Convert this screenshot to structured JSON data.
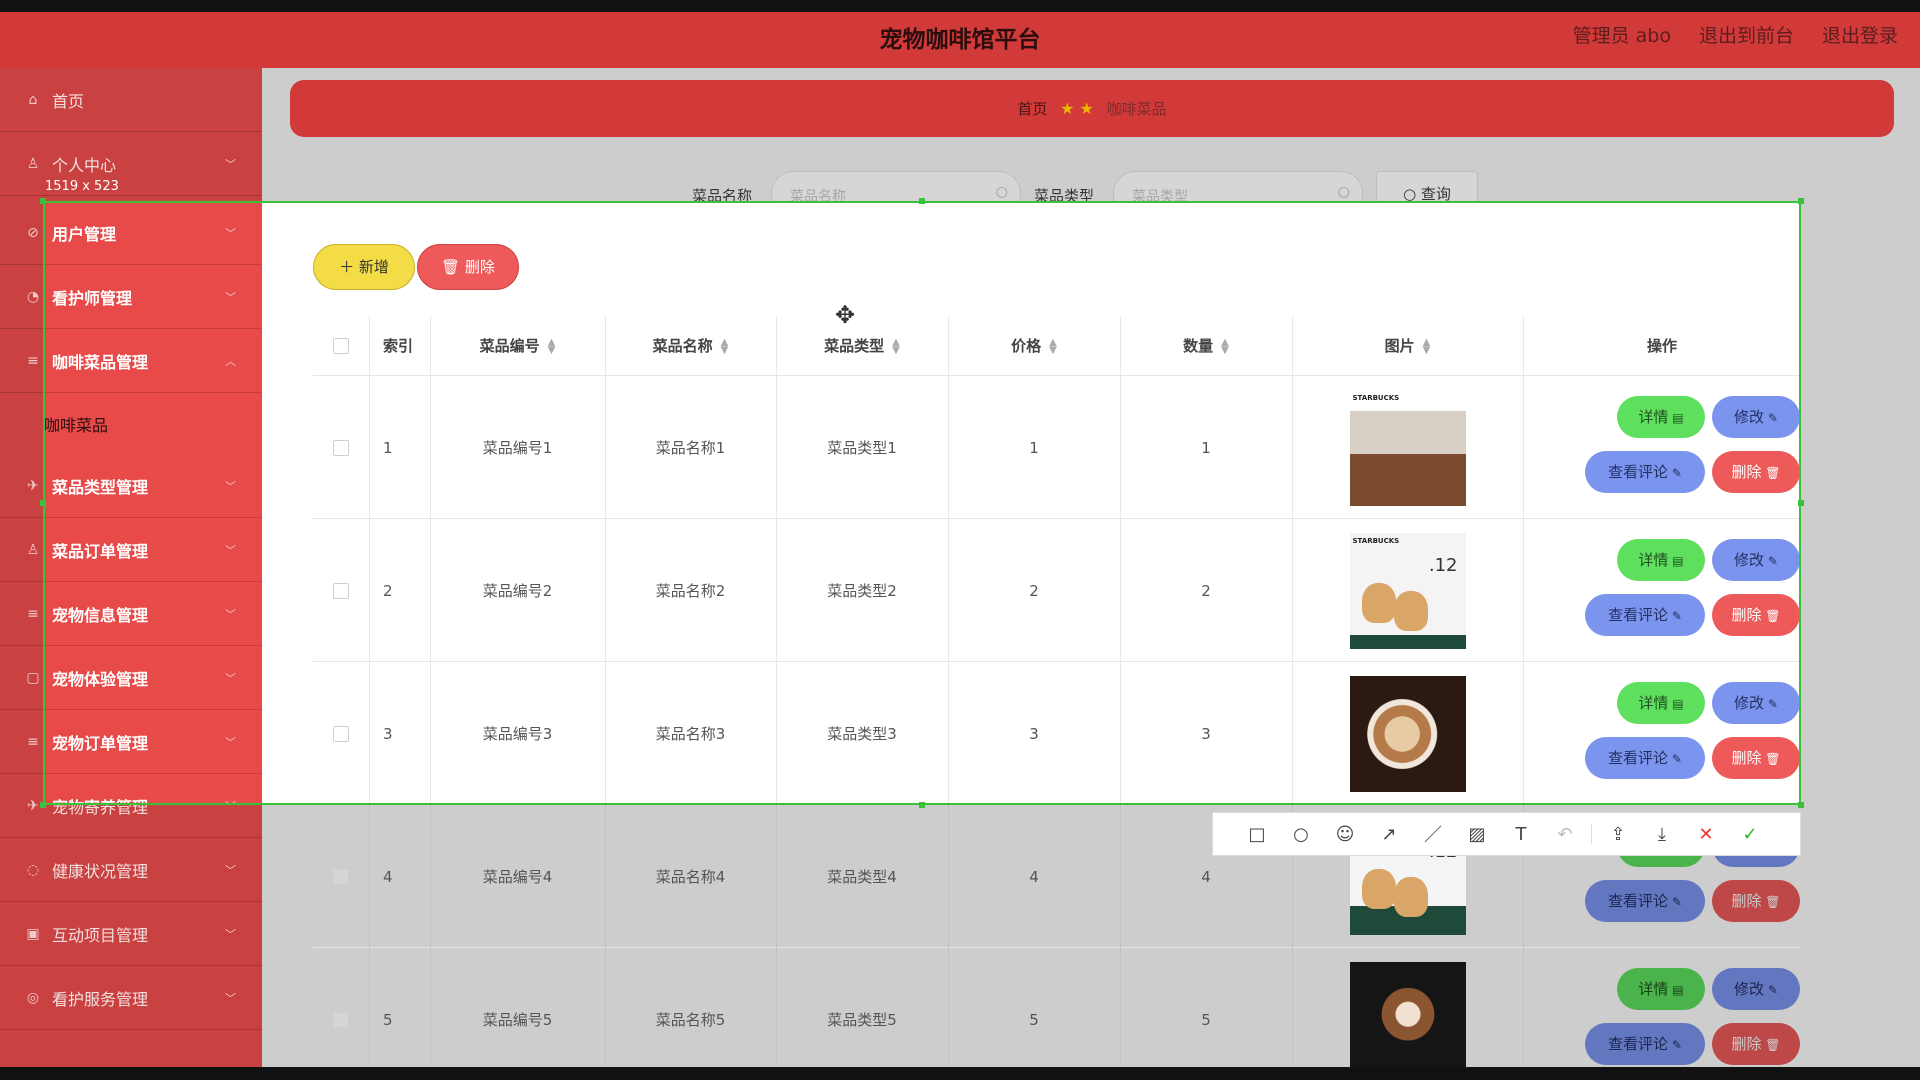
{
  "app": {
    "title": "宠物咖啡馆平台",
    "header_links": [
      "管理员 abo",
      "退出到前台",
      "退出登录"
    ]
  },
  "breadcrumb": {
    "home": "首页",
    "current": "咖啡菜品"
  },
  "sidebar": {
    "items": [
      {
        "label": "首页",
        "icon": "home-icon"
      },
      {
        "label": "个人中心",
        "icon": "user-icon"
      },
      {
        "label": "用户管理",
        "icon": "users-icon"
      },
      {
        "label": "看护师管理",
        "icon": "nurse-icon"
      },
      {
        "label": "咖啡菜品管理",
        "icon": "menu-icon"
      },
      {
        "label": "菜品类型管理",
        "icon": "tag-icon"
      },
      {
        "label": "菜品订单管理",
        "icon": "order-icon"
      },
      {
        "label": "宠物信息管理",
        "icon": "list-icon"
      },
      {
        "label": "宠物体验管理",
        "icon": "calendar-icon"
      },
      {
        "label": "宠物订单管理",
        "icon": "list-icon"
      },
      {
        "label": "宠物寄养管理",
        "icon": "home2-icon"
      },
      {
        "label": "健康状况管理",
        "icon": "heart-icon"
      },
      {
        "label": "互动项目管理",
        "icon": "grid-icon"
      },
      {
        "label": "看护服务管理",
        "icon": "service-icon"
      }
    ],
    "sub_item": "咖啡菜品"
  },
  "search": {
    "name_label": "菜品名称",
    "name_placeholder": "菜品名称",
    "type_label": "菜品类型",
    "type_placeholder": "菜品类型",
    "query_button": "查询"
  },
  "actions": {
    "add": "新增",
    "delete": "删除"
  },
  "table": {
    "headers": [
      "索引",
      "菜品编号",
      "菜品名称",
      "菜品类型",
      "价格",
      "数量",
      "图片",
      "操作"
    ],
    "rows": [
      {
        "index": "1",
        "code": "菜品编号1",
        "name": "菜品名称1",
        "type": "菜品类型1",
        "price": "1",
        "qty": "1"
      },
      {
        "index": "2",
        "code": "菜品编号2",
        "name": "菜品名称2",
        "type": "菜品类型2",
        "price": "2",
        "qty": "2"
      },
      {
        "index": "3",
        "code": "菜品编号3",
        "name": "菜品名称3",
        "type": "菜品类型3",
        "price": "3",
        "qty": "3"
      },
      {
        "index": "4",
        "code": "菜品编号4",
        "name": "菜品名称4",
        "type": "菜品类型4",
        "price": "4",
        "qty": "4"
      },
      {
        "index": "5",
        "code": "菜品编号5",
        "name": "菜品名称5",
        "type": "菜品类型5",
        "price": "5",
        "qty": "5"
      }
    ],
    "row_buttons": {
      "detail": "详情",
      "edit": "修改",
      "comment": "查看评论",
      "delete": "删除"
    }
  },
  "screenshot_tool": {
    "dimensions": "1519 x 523"
  },
  "image_text": {
    "brand": "STARBUCKS",
    "promo_number": ".12"
  },
  "colors": {
    "header": "#d23a3a",
    "selection": "#39c139",
    "add": "#f3dc45",
    "danger": "#ee5a5a",
    "primary": "#7b95ef",
    "success": "#5ee05e"
  }
}
